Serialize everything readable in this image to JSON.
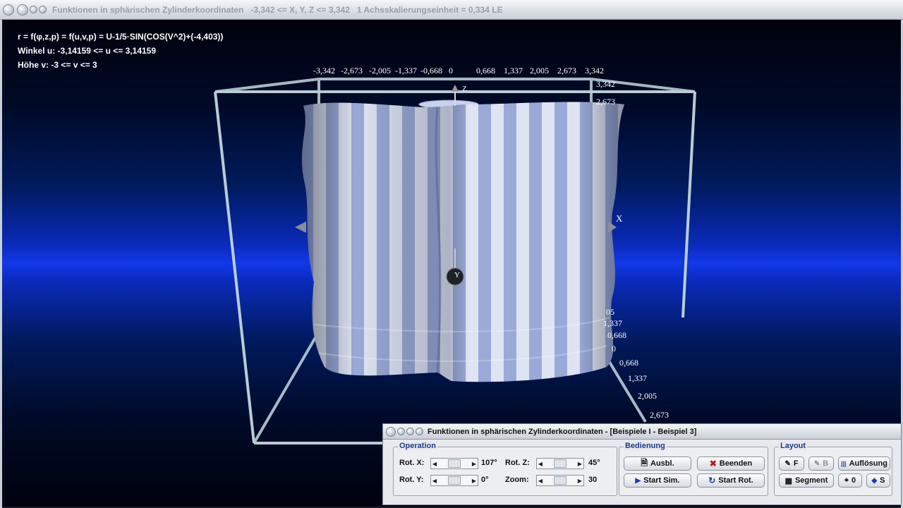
{
  "window": {
    "title": "Funktionen in sphärischen Zylinderkoordinaten   -3,342 <= X, Y, Z <= 3,342   1 Achsskalierungseinheit = 0,334 LE"
  },
  "info": {
    "formula": "r = f(φ,z,p) = f(u,v,p) = U-1/5·SIN(COS(V^2)+(-4,403))",
    "angle": "Winkel u: -3,14159 <= u <= 3,14159",
    "height": "Höhe v: -3 <= v <= 3"
  },
  "axes": {
    "top_ticks": [
      "-3,342",
      "-2,673",
      "-2,005",
      "-1,337",
      "-0,668",
      "0",
      "0,668",
      "1,337",
      "2,005",
      "2,673",
      "3,342"
    ],
    "z_ticks": [
      "3,342",
      "2,673"
    ],
    "y_ticks": [
      "05",
      "1,337",
      "0,668",
      "0",
      "0,668",
      "1,337",
      "2,005",
      "2,673"
    ],
    "x_label": "X",
    "y_label": "Y",
    "z_label": "Z"
  },
  "panel": {
    "title": "Funktionen in sphärischen Zylinderkoordinaten - [Beispiele I - Beispiel 3]",
    "operation": {
      "label": "Operation",
      "rot_x_label": "Rot. X:",
      "rot_x_value": "107°",
      "rot_y_label": "Rot. Y:",
      "rot_y_value": "0°",
      "rot_z_label": "Rot. Z:",
      "rot_z_value": "45°",
      "zoom_label": "Zoom:",
      "zoom_value": "30"
    },
    "bedienung": {
      "label": "Bedienung",
      "ausbl": "Ausbl.",
      "beenden": "Beenden",
      "start_sim": "Start Sim.",
      "start_rot": "Start Rot."
    },
    "layout": {
      "label": "Layout",
      "f": "F",
      "b": "B",
      "aufloesung": "Auflösung",
      "segment": "Segment",
      "zero": "0",
      "s": "S"
    }
  }
}
